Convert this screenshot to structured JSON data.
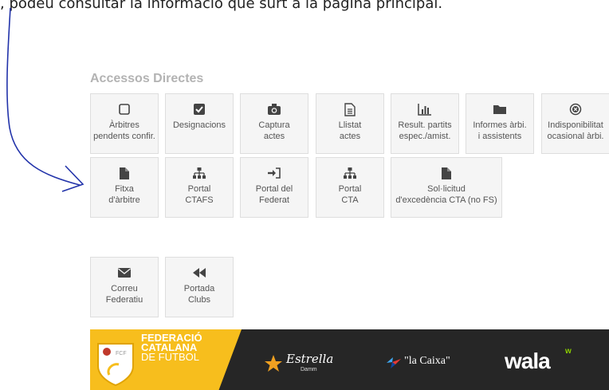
{
  "top_text": ", podeu consultar la informació que surt a la pàgina principal.",
  "section_title": "Accessos Directes",
  "row1": [
    {
      "line1": "Àrbitres",
      "line2": "pendents confir.",
      "icon": "square-icon"
    },
    {
      "line1": "Designacions",
      "line2": "",
      "icon": "check-square-icon"
    },
    {
      "line1": "Captura",
      "line2": "actes",
      "icon": "camera-icon"
    },
    {
      "line1": "Llistat",
      "line2": "actes",
      "icon": "document-text-icon"
    },
    {
      "line1": "Result. partits",
      "line2": "espec./amist.",
      "icon": "bar-chart-icon"
    },
    {
      "line1": "Informes àrbi.",
      "line2": "i assistents",
      "icon": "folder-icon"
    },
    {
      "line1": "Indisponibilitat",
      "line2": "ocasional àrbi.",
      "icon": "times-circle-icon"
    }
  ],
  "row2": [
    {
      "line1": "Fitxa",
      "line2": "d'àrbitre",
      "icon": "file-icon"
    },
    {
      "line1": "Portal",
      "line2": "CTAFS",
      "icon": "sitemap-icon"
    },
    {
      "line1": "Portal del",
      "line2": "Federat",
      "icon": "sign-in-icon"
    },
    {
      "line1": "Portal",
      "line2": "CTA",
      "icon": "sitemap-icon"
    },
    {
      "line1": "Sol·licitud",
      "line2": "d'excedència CTA (no FS)",
      "icon": "file-icon"
    }
  ],
  "row3": [
    {
      "line1": "Correu",
      "line2": "Federatiu",
      "icon": "envelope-icon"
    },
    {
      "line1": "Portada",
      "line2": "Clubs",
      "icon": "backward-icon"
    }
  ],
  "footer": {
    "fed_line1": "FEDERACIÓ",
    "fed_line2": "CATALANA",
    "fed_line3": "DE FUTBOL",
    "logo_text": "FCF",
    "sponsor1": "Estrella",
    "sponsor1_sub": "Damm",
    "sponsor2": "\"la Caixa\"",
    "sponsor3": "wala",
    "sponsor3_mark": "w"
  },
  "colors": {
    "tile_bg": "#f5f5f5",
    "icon": "#444444",
    "footer_bg": "#262626",
    "footer_yellow": "#f7be1d",
    "annotation": "#2233aa"
  }
}
